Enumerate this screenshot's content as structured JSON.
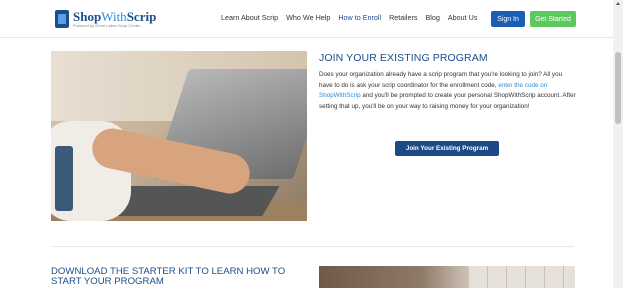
{
  "header": {
    "logo": {
      "name_a": "Shop",
      "name_b": "With",
      "name_c": "Scrip",
      "tagline": "Powered by Great Lakes Scrip Center"
    },
    "nav": [
      {
        "label": "Learn About Scrip",
        "active": false
      },
      {
        "label": "Who We Help",
        "active": false
      },
      {
        "label": "How to Enroll",
        "active": true
      },
      {
        "label": "Retailers",
        "active": false
      },
      {
        "label": "Blog",
        "active": false
      },
      {
        "label": "About Us",
        "active": false
      }
    ],
    "sign_in": "Sign In",
    "get_started": "Get Started"
  },
  "section_join": {
    "title": "JOIN YOUR EXISTING PROGRAM",
    "body_part1": "Does your organization already have a scrip program that you're looking to join? All you have to do is ask your scrip coordinator for the enrollment code, ",
    "body_link": "enter the code on ShopWithScrip",
    "body_part2": " and you'll be prompted to create your personal ShopWithScrip account. After setting that up, you'll be on your way to raising money for your organization!",
    "button": "Join Your Existing Program"
  },
  "section_starter": {
    "title": "DOWNLOAD THE STARTER KIT TO LEARN HOW TO START YOUR PROGRAM"
  }
}
